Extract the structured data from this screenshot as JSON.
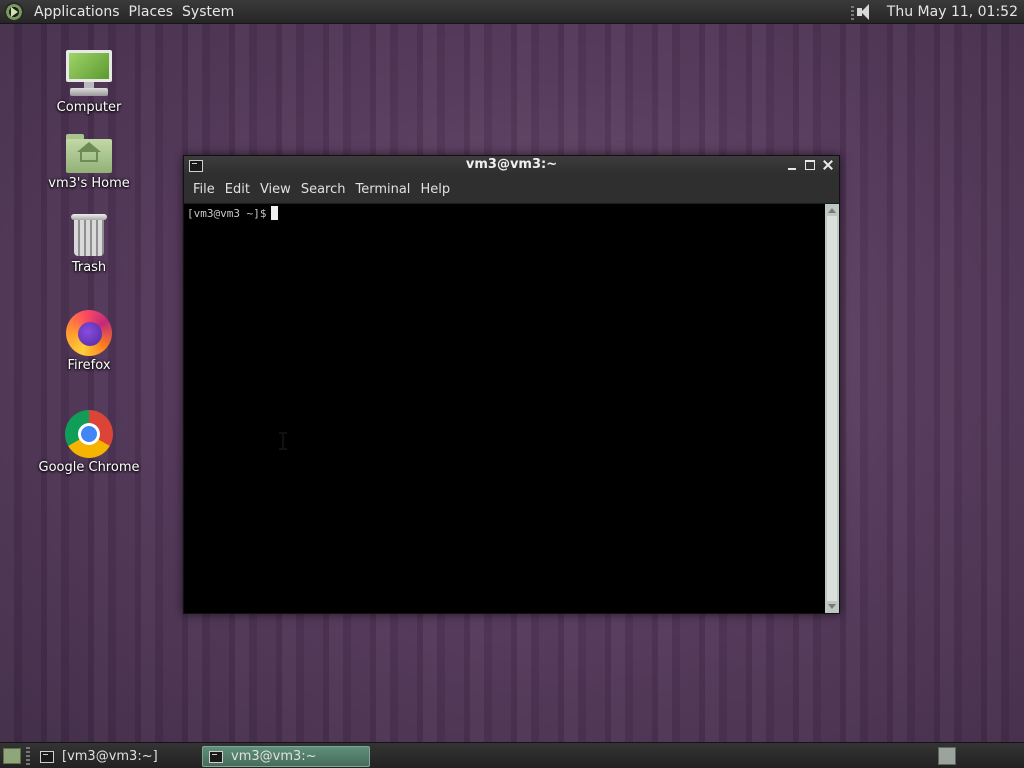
{
  "top_panel": {
    "menus": [
      "Applications",
      "Places",
      "System"
    ],
    "clock": "Thu May 11, 01:52",
    "icons": [
      "distro-menu-icon",
      "speaker-icon"
    ]
  },
  "desktop": {
    "icons": [
      {
        "label": "Computer",
        "icon": "computer-icon"
      },
      {
        "label": "vm3's Home",
        "icon": "home-folder-icon"
      },
      {
        "label": "Trash",
        "icon": "trash-icon"
      },
      {
        "label": "Firefox",
        "icon": "firefox-icon"
      },
      {
        "label": "Google Chrome",
        "icon": "chrome-icon"
      }
    ]
  },
  "terminal": {
    "title": "vm3@vm3:~",
    "menu": [
      "File",
      "Edit",
      "View",
      "Search",
      "Terminal",
      "Help"
    ],
    "prompt": "[vm3@vm3 ~]$",
    "colors": {
      "background": "#000000",
      "text": "#c8c8c8"
    }
  },
  "bottom_panel": {
    "tasks": [
      "[vm3@vm3:~]",
      "vm3@vm3:~"
    ],
    "active_task_index": 1
  }
}
